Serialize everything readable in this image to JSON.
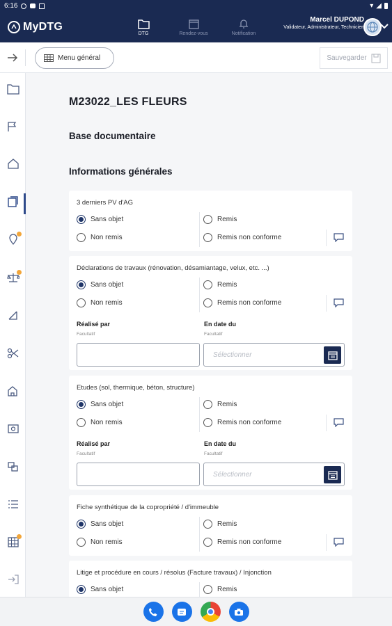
{
  "status_bar": {
    "time": "6:16"
  },
  "app": {
    "name": "MyDTG"
  },
  "nav": [
    {
      "label": "DTG",
      "icon": "folder-icon",
      "active": true
    },
    {
      "label": "Rendez-vous",
      "icon": "calendar-icon",
      "active": false
    },
    {
      "label": "Notification",
      "icon": "bell-icon",
      "active": false
    }
  ],
  "user": {
    "name": "Marcel DUPOND",
    "roles": "Validateur, Administrateur, Technicien"
  },
  "toolbar": {
    "menu_label": "Menu général",
    "save_label": "Sauvegarder"
  },
  "page": {
    "title": "M23022_LES FLEURS",
    "section": "Base documentaire",
    "subsection": "Informations générales"
  },
  "options": {
    "sans_objet": "Sans objet",
    "non_remis": "Non remis",
    "remis": "Remis",
    "remis_non_conforme": "Remis non conforme"
  },
  "form_labels": {
    "realise_par": "Réalisé par",
    "en_date_du": "En date du",
    "facultatif": "Facultatif",
    "date_placeholder": "Sélectionner"
  },
  "documents": [
    {
      "question": "3 derniers PV d'AG",
      "selected": "Sans objet",
      "has_fields": false
    },
    {
      "question": "Déclarations de travaux (rénovation, désamiantage, velux, etc. ...)",
      "selected": "Sans objet",
      "has_fields": true
    },
    {
      "question": "Etudes (sol, thermique, béton, structure)",
      "selected": "Sans objet",
      "has_fields": true
    },
    {
      "question": "Fiche synthétique de la copropriété / d'immeuble",
      "selected": "Sans objet",
      "has_fields": false
    },
    {
      "question": "Litige et procédure en cours / résolus (Facture travaux) / Injonction",
      "selected": "Sans objet",
      "has_fields": false
    }
  ],
  "sidebar_icons": [
    "folder-icon",
    "flag-icon",
    "house-icon",
    "documents-icon",
    "location-icon",
    "scale-icon",
    "ruler-icon",
    "cut-icon",
    "building-icon",
    "image-icon",
    "layers-icon",
    "checklist-icon",
    "grid-icon",
    "logout-icon"
  ],
  "colors": {
    "primary": "#1a2a52",
    "accent_dot": "#f2a63a"
  }
}
